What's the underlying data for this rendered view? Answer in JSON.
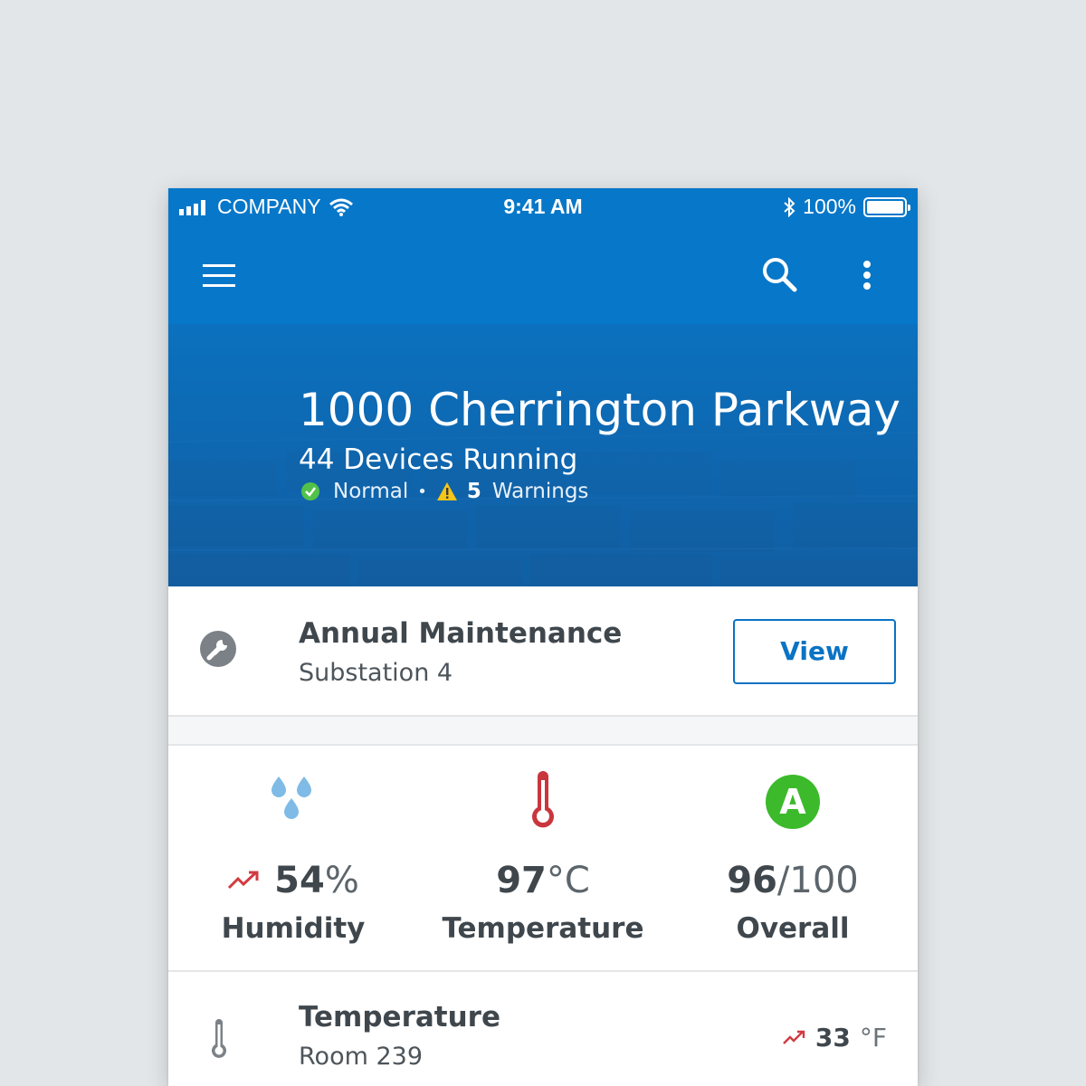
{
  "status_bar": {
    "carrier": "COMPANY",
    "time": "9:41 AM",
    "battery": "100%"
  },
  "toolbar": {
    "menu_icon": "menu-icon",
    "search_icon": "search-icon",
    "more_icon": "more-vert-icon"
  },
  "site": {
    "title": "1000 Cherrington Parkway",
    "devices": "44 Devices Running",
    "normal_label": "Normal",
    "separator": "•",
    "warning_count": "5",
    "warning_label": "Warnings"
  },
  "maintenance": {
    "title": "Annual Maintenance",
    "subtitle": "Substation 4",
    "button_label": "View"
  },
  "stats": [
    {
      "value": "54",
      "unit": "%",
      "label": "Humidity",
      "icon": "humidity-drops-icon",
      "trend": "trending-up-icon"
    },
    {
      "value": "97",
      "unit": "°C",
      "label": "Temperature",
      "icon": "thermometer-icon"
    },
    {
      "value": "96",
      "unit": "/100",
      "label": "Overall",
      "icon": "grade-a-icon",
      "grade": "A"
    }
  ],
  "list_row": {
    "title": "Temperature",
    "subtitle": "Room 239",
    "value": "33",
    "unit": "°F",
    "icon": "thermometer-icon",
    "trend": "trending-up-icon"
  },
  "colors": {
    "primary": "#0777c9",
    "text": "#3f474d",
    "humidity": "#7fbbe6",
    "temperature": "#c8373d",
    "grade": "#3cba2b",
    "warning": "#f5c518",
    "normal": "#52c14a"
  }
}
